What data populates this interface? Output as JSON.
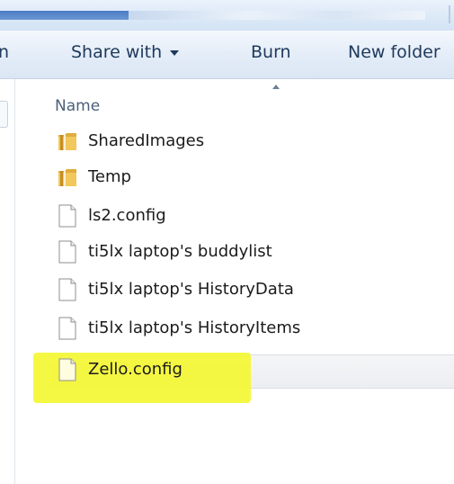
{
  "toolbar": {
    "cut_label": "n",
    "share_label": "Share with",
    "burn_label": "Burn",
    "new_folder_label": "New folder"
  },
  "columns": {
    "name_label": "Name"
  },
  "files": [
    {
      "name": "SharedImages",
      "type": "folder",
      "selected": false,
      "highlighted": false
    },
    {
      "name": "Temp",
      "type": "folder",
      "selected": false,
      "highlighted": false
    },
    {
      "name": "ls2.config",
      "type": "file",
      "selected": false,
      "highlighted": false
    },
    {
      "name": "ti5lx laptop's buddylist",
      "type": "file",
      "selected": false,
      "highlighted": false
    },
    {
      "name": "ti5lx laptop's HistoryData",
      "type": "file",
      "selected": false,
      "highlighted": false
    },
    {
      "name": "ti5lx laptop's HistoryItems",
      "type": "file",
      "selected": false,
      "highlighted": false
    },
    {
      "name": "Zello.config",
      "type": "file",
      "selected": true,
      "highlighted": true
    }
  ],
  "colors": {
    "highlight": "#f4f732",
    "folder": "#e6b84a",
    "toolbar_text": "#1e395b"
  }
}
